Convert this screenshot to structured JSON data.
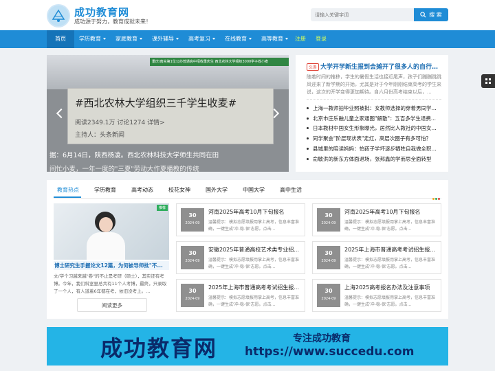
{
  "header": {
    "site_name": "成功教育网",
    "tagline": "成功源于努力，教育成就未来！",
    "search_placeholder": "请输入关键字词",
    "search_button": "搜 索"
  },
  "nav": {
    "items": [
      {
        "label": "首页"
      },
      {
        "label": "学历教育"
      },
      {
        "label": "家庭教育"
      },
      {
        "label": "课外辅导"
      },
      {
        "label": "高考复习"
      },
      {
        "label": "在线教育"
      },
      {
        "label": "高等教育"
      },
      {
        "label": "注册"
      },
      {
        "label": "登录"
      }
    ]
  },
  "banner": {
    "overlay_text": "重庆/南充第1位公办普通高中招收重庆生 西北农林大学组织3000学子收小麦",
    "headline": "#西北农林大学组织三千学生收麦#",
    "stats": "阅读2349.1万  讨论1274  详情>",
    "host": "主持人：头条新闻",
    "caption_line1": "据：6月14日，陕西杨凌。西北农林科技大学师生共同在田",
    "caption_line2": "间忙小麦，一年一度的\"三夏\"劳动大作夏播教的传统"
  },
  "top_news": {
    "tag": "头条",
    "title": "大学开学新生报到会摊开了很多人的自行车，图...",
    "summary": "随着时间的推移，学生的暑假生活也接近尾声，孩子们蹦蹦跳跳风迎来了新学期的开始，尤其是对于今年刚刚结束高考的学生来说，这次的开学变得更加期待。自六月份高考结束以后，..."
  },
  "news_list": [
    "上海一教师拍毕业照被批：女教师选择的穿着男同学...",
    "北京市庄乐融儿童之家通图\"解散\"：五百多学生退费...",
    "日本教材中国女生形象曝光，居然比人教社的中国女...",
    "同学聚会\"阶层现状表\"走红，高层次圈子有多可怕？",
    "县城里的陪读妈妈：怕孩子学坏逐步牺牲自我做全职...",
    "俞敏洪的新东方体面退场，张邦鑫的学而思全面转型"
  ],
  "section": {
    "tabs": [
      "教育热点",
      "学历教育",
      "高考动态",
      "校花女神",
      "国外大学",
      "中国大学",
      "高中生活"
    ]
  },
  "featured": {
    "tag": "推荐",
    "title": "博士研究生手握论文12篇，为何被导师批\"不...",
    "summary": "文/学个习越来越\"卷\"的不止是考研（硕士），其实还有考博。今年，我们科室里总共有11个人考博，最终，只录取了一个人，有人道着6年都在考，依旧没考上。...",
    "more": "阅读更多"
  },
  "grid_items": [
    {
      "day": "30",
      "ym": "2024-09",
      "title": "河南2025年高考10月下旬报名",
      "desc": "温馨提示：模拟志愿填报用掌上高考，信息丰富准确，一键生成'冲-稳-保'志愿。点击..."
    },
    {
      "day": "30",
      "ym": "2024-09",
      "title": "河南2025年高考10月下旬报名",
      "desc": "温馨提示：模拟志愿填报用掌上高考，信息丰富准确，一键生成'冲-稳-保'志愿。点击..."
    },
    {
      "day": "30",
      "ym": "2024-09",
      "title": "安徽2025年普通高校艺术类专业招...",
      "desc": "温馨提示：模拟志愿填报用掌上高考，信息丰富准确，一键生成'冲-稳-保'志愿。点击..."
    },
    {
      "day": "30",
      "ym": "2024-09",
      "title": "2025年上海市普通高考考试招生报...",
      "desc": "温馨提示：模拟志愿填报用掌上高考，信息丰富准确，一键生成'冲-稳-保'志愿。点击..."
    },
    {
      "day": "30",
      "ym": "2024-09",
      "title": "2025年上海市普通高考考试招生报...",
      "desc": "温馨提示：模拟志愿填报用掌上高考，信息丰富准确，一键生成'冲-稳-保'志愿。点击..."
    },
    {
      "day": "30",
      "ym": "2024-09",
      "title": "上海2025高考报名办法及注意事项",
      "desc": "温馨提示：模拟志愿填报用掌上高考，信息丰富准确，一键生成'冲-稳-保'志愿。点击..."
    }
  ],
  "ad": {
    "title": "成功教育网",
    "slogan": "专注成功教育",
    "url": "https://www.succedu.com"
  },
  "colors": {
    "brand": "#1f8cd6",
    "nav_active": "#1573b8",
    "accent_register": "#d8ff5a",
    "tag_red": "#e0463a",
    "ad_bg": "#24b4e6"
  },
  "icons": [
    "logo-icon",
    "search-icon",
    "arrow-left-icon",
    "arrow-right-icon",
    "grid-menu-icon",
    "caret-down-icon"
  ]
}
